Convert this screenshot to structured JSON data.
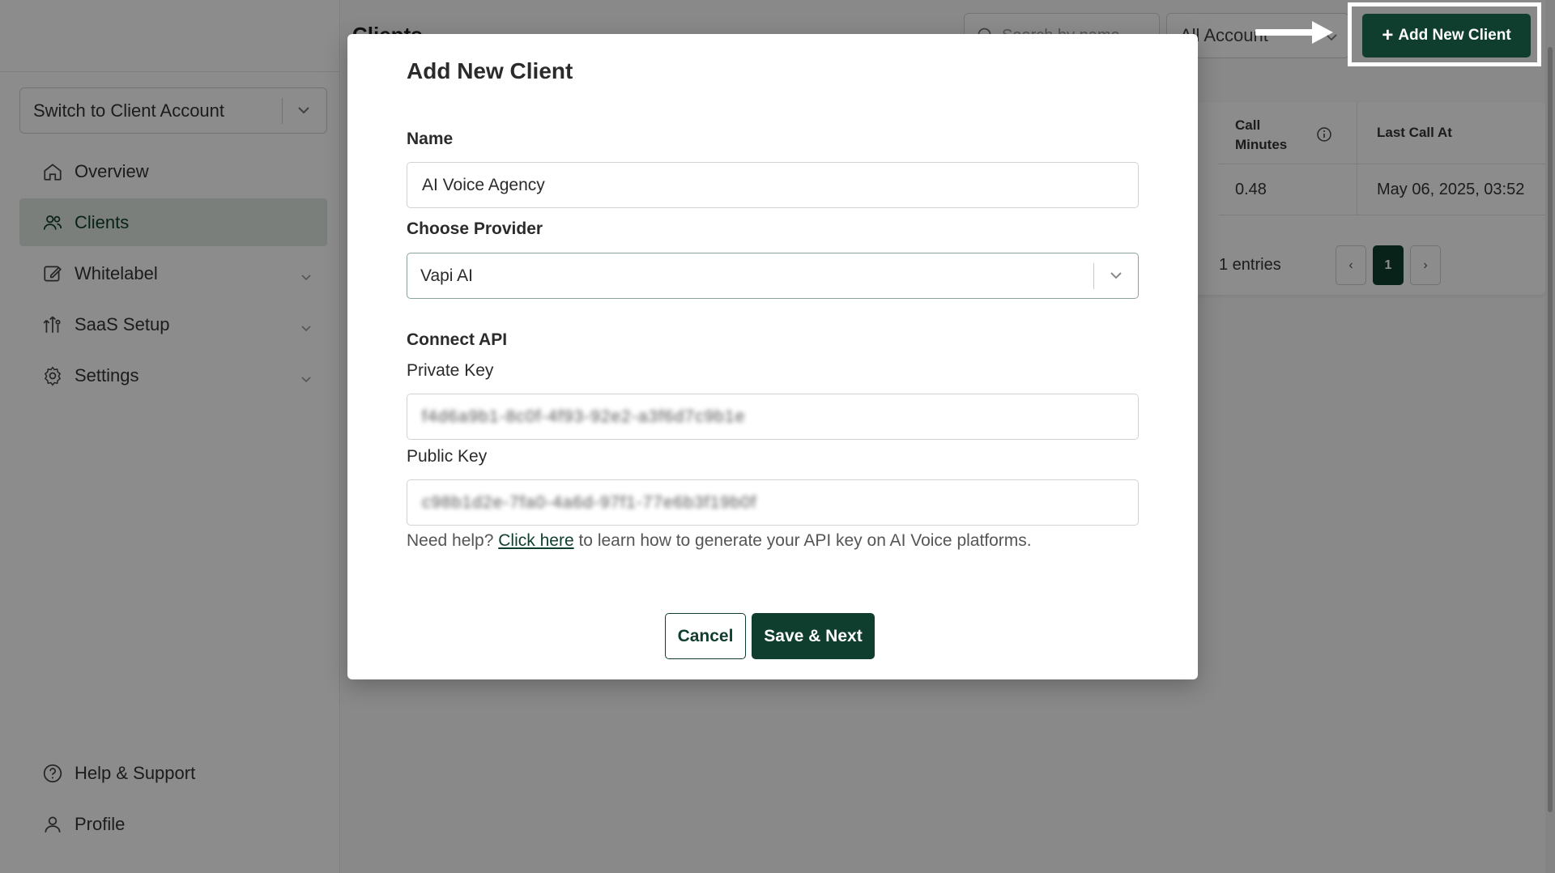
{
  "sidebar": {
    "switcher_label": "Switch to Client Account",
    "items": [
      {
        "label": "Overview",
        "icon": "home-icon"
      },
      {
        "label": "Clients",
        "icon": "users-icon"
      },
      {
        "label": "Whitelabel",
        "icon": "edit-icon"
      },
      {
        "label": "SaaS Setup",
        "icon": "saas-icon"
      },
      {
        "label": "Settings",
        "icon": "gear-icon"
      }
    ],
    "bottom_items": [
      {
        "label": "Help & Support",
        "icon": "help-icon"
      },
      {
        "label": "Profile",
        "icon": "user-icon"
      }
    ]
  },
  "header": {
    "title": "Clients",
    "search_placeholder": "Search by name",
    "account_filter": "All Account",
    "add_button": "Add New Client"
  },
  "table": {
    "col_call_minutes": "Call Minutes",
    "col_last_call": "Last Call At",
    "rows": [
      {
        "call_minutes": "0.48",
        "last_call": "May 06, 2025, 03:52"
      }
    ],
    "entries_text": "1 entries",
    "current_page": "1"
  },
  "modal": {
    "title": "Add New Client",
    "name_label": "Name",
    "name_value": "AI Voice Agency",
    "provider_label": "Choose Provider",
    "provider_value": "Vapi AI",
    "connect_api_label": "Connect API",
    "private_key_label": "Private Key",
    "private_key_value": "f4d6a9b1-8c0f-4f93-92e2-a3f6d7c9b1e",
    "public_key_label": "Public Key",
    "public_key_value": "c98b1d2e-7fa0-4a6d-97f1-77e6b3f19b0f",
    "help_prefix": "Need help? ",
    "help_link": "Click here",
    "help_suffix": " to learn how to generate your API key on AI Voice platforms.",
    "cancel_button": "Cancel",
    "save_button": "Save & Next"
  },
  "colors": {
    "brand_dark_green": "#0f3d2e",
    "active_nav_bg": "#dfe7e2",
    "overlay": "rgba(0,0,0,0.45)"
  }
}
